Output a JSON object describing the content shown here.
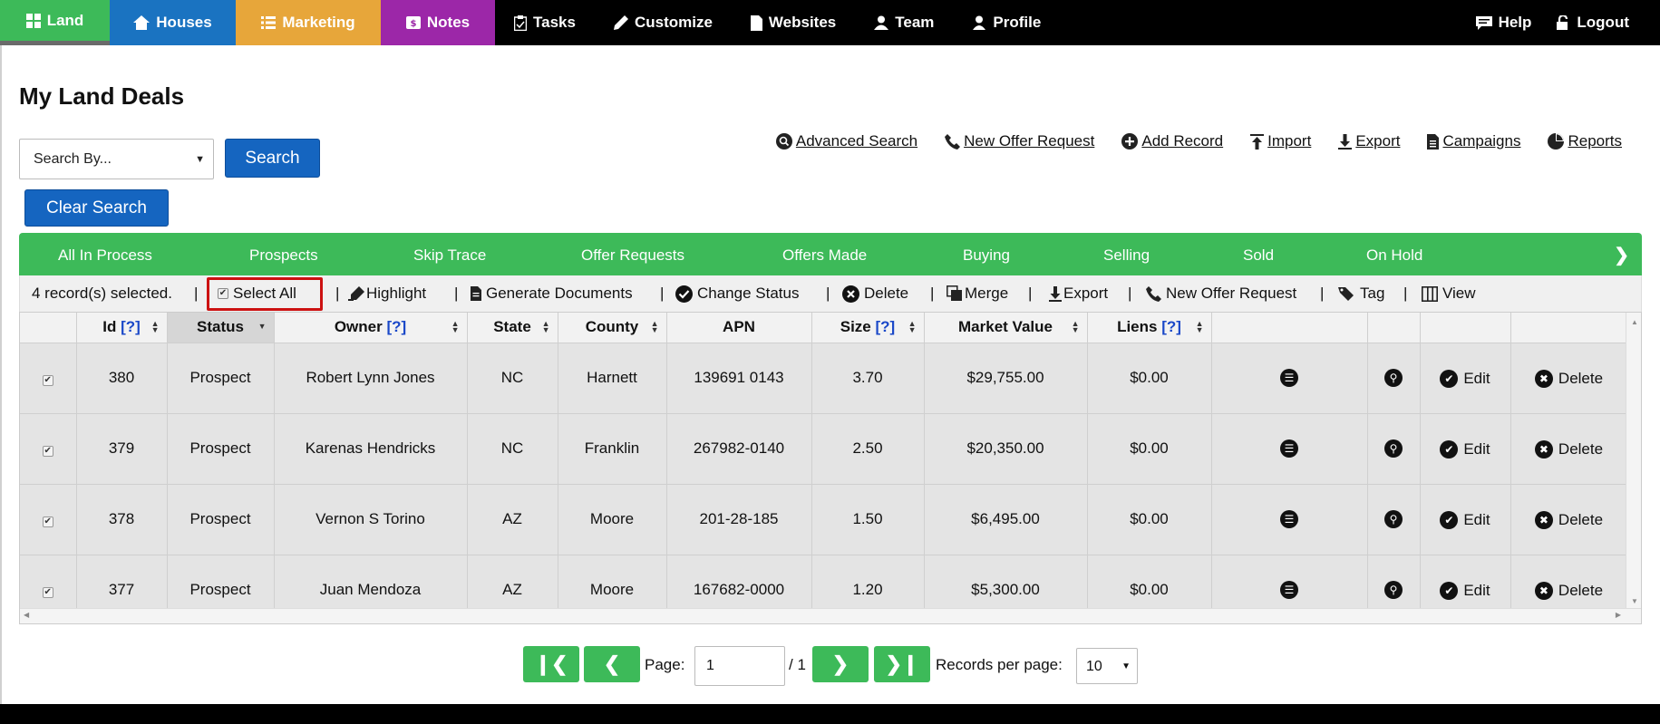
{
  "nav": {
    "land": "Land",
    "houses": "Houses",
    "marketing": "Marketing",
    "notes": "Notes",
    "tasks": "Tasks",
    "customize": "Customize",
    "websites": "Websites",
    "team": "Team",
    "profile": "Profile",
    "help": "Help",
    "logout": "Logout"
  },
  "page": {
    "title": "My Land Deals"
  },
  "search": {
    "select_value": "Search By...",
    "search_label": "Search",
    "clear_label": "Clear Search"
  },
  "actions": {
    "advanced_search": "Advanced Search",
    "new_offer_request": "New Offer Request",
    "add_record": "Add Record",
    "import": "Import",
    "export": "Export",
    "campaigns": "Campaigns",
    "reports": "Reports"
  },
  "status_tabs": [
    "All In Process",
    "Prospects",
    "Skip Trace",
    "Offer Requests",
    "Offers Made",
    "Buying",
    "Selling",
    "Sold",
    "On Hold"
  ],
  "status_arrow": "❯",
  "toolbar": {
    "selected": "4 record(s) selected.",
    "select_all": "Select All",
    "highlight": "Highlight",
    "generate_documents": "Generate Documents",
    "change_status": "Change Status",
    "delete": "Delete",
    "merge": "Merge",
    "export": "Export",
    "new_offer_request": "New Offer Request",
    "tag": "Tag",
    "view": "View",
    "separator": "|"
  },
  "table": {
    "headers": {
      "id": "Id",
      "status": "Status",
      "owner": "Owner",
      "state": "State",
      "county": "County",
      "apn": "APN",
      "size": "Size",
      "market_value": "Market Value",
      "liens": "Liens",
      "help": "[?]"
    },
    "edit_label": "Edit",
    "delete_label": "Delete",
    "rows": [
      {
        "id": "380",
        "status": "Prospect",
        "owner": "Robert Lynn Jones",
        "state": "NC",
        "county": "Harnett",
        "apn": "139691 0143",
        "size": "3.70",
        "market_value": "$29,755.00",
        "liens": "$0.00"
      },
      {
        "id": "379",
        "status": "Prospect",
        "owner": "Karenas Hendricks",
        "state": "NC",
        "county": "Franklin",
        "apn": "267982-0140",
        "size": "2.50",
        "market_value": "$20,350.00",
        "liens": "$0.00"
      },
      {
        "id": "378",
        "status": "Prospect",
        "owner": "Vernon S Torino",
        "state": "AZ",
        "county": "Moore",
        "apn": "201-28-185",
        "size": "1.50",
        "market_value": "$6,495.00",
        "liens": "$0.00"
      },
      {
        "id": "377",
        "status": "Prospect",
        "owner": "Juan Mendoza",
        "state": "AZ",
        "county": "Moore",
        "apn": "167682-0000",
        "size": "1.20",
        "market_value": "$5,300.00",
        "liens": "$0.00"
      }
    ]
  },
  "pager": {
    "first": "❙❮",
    "prev": "❮",
    "next": "❯",
    "last": "❯❙",
    "page_label": "Page:",
    "page_value": "1",
    "of_label": "/ 1",
    "rpp_label": "Records per page:",
    "rpp_value": "10"
  },
  "colors": {
    "green": "#3dba59",
    "blue": "#1565c0",
    "purple": "#9c27a8",
    "orange": "#e7a63a"
  }
}
